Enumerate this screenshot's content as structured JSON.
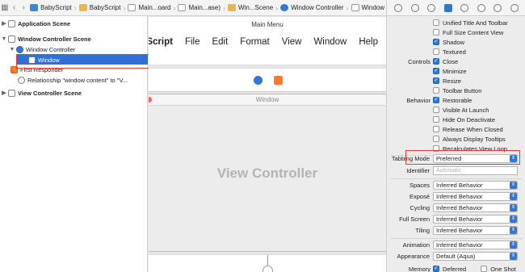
{
  "jumpbar": {
    "breadcrumbs": [
      "BabyScript",
      "BabyScript",
      "Main...oard",
      "Main...ase)",
      "Win...Scene",
      "Window Controller",
      "Window"
    ]
  },
  "outline": {
    "application_scene": "Application Scene",
    "window_controller_scene": "Window Controller Scene",
    "window_controller": "Window Controller",
    "window": "Window",
    "first_responder": "First Responder",
    "relationship": "Relationship \"window content\" to \"V...",
    "view_controller_scene": "View Controller Scene"
  },
  "canvas": {
    "menu_title": "Main Menu",
    "menubar": [
      "BabyScript",
      "File",
      "Edit",
      "Format",
      "View",
      "Window",
      "Help"
    ],
    "window_title": "Window",
    "vc_label": "View Controller"
  },
  "inspector": {
    "appearance_checks": [
      {
        "label": "",
        "text": "Unified Title And Toolbar",
        "checked": false
      },
      {
        "label": "",
        "text": "Full Size Content View",
        "checked": false
      },
      {
        "label": "",
        "text": "Shadow",
        "checked": true
      },
      {
        "label": "",
        "text": "Textured",
        "checked": false
      }
    ],
    "controls_label": "Controls",
    "controls_checks": [
      {
        "text": "Close",
        "checked": true
      },
      {
        "text": "Minimize",
        "checked": true
      },
      {
        "text": "Resize",
        "checked": true
      },
      {
        "text": "Toolbar Button",
        "checked": false
      }
    ],
    "behavior_label": "Behavior",
    "behavior_checks": [
      {
        "text": "Restorable",
        "checked": true
      },
      {
        "text": "Visible At Launch",
        "checked": false
      },
      {
        "text": "Hide On Deactivate",
        "checked": false
      },
      {
        "text": "Release When Closed",
        "checked": false
      },
      {
        "text": "Always Display Tooltips",
        "checked": false
      },
      {
        "text": "Recalculates View Loop",
        "checked": false
      }
    ],
    "tabbing_mode_label": "Tabbing Mode",
    "tabbing_mode_value": "Preferred",
    "identifier_label": "Identifier",
    "identifier_placeholder": "Automatic",
    "spaces_label": "Spaces",
    "spaces_value": "Inferred Behavior",
    "expose_label": "Exposé",
    "expose_value": "Inferred Behavior",
    "cycling_label": "Cycling",
    "cycling_value": "Inferred Behavior",
    "fullscreen_label": "Full Screen",
    "fullscreen_value": "Inferred Behavior",
    "tiling_label": "Tiling",
    "tiling_value": "Inferred Behavior",
    "animation_label": "Animation",
    "animation_value": "Inferred Behavior",
    "appearance_label": "Appearance",
    "appearance_value": "Default (Aqua)",
    "memory_label": "Memory",
    "memory_deferred": "Deferred",
    "memory_oneshot": "One Shot"
  },
  "colors": {
    "selection": "#2f6fd6",
    "accent": "#2f78d8",
    "annotation": "#e23c3c"
  }
}
